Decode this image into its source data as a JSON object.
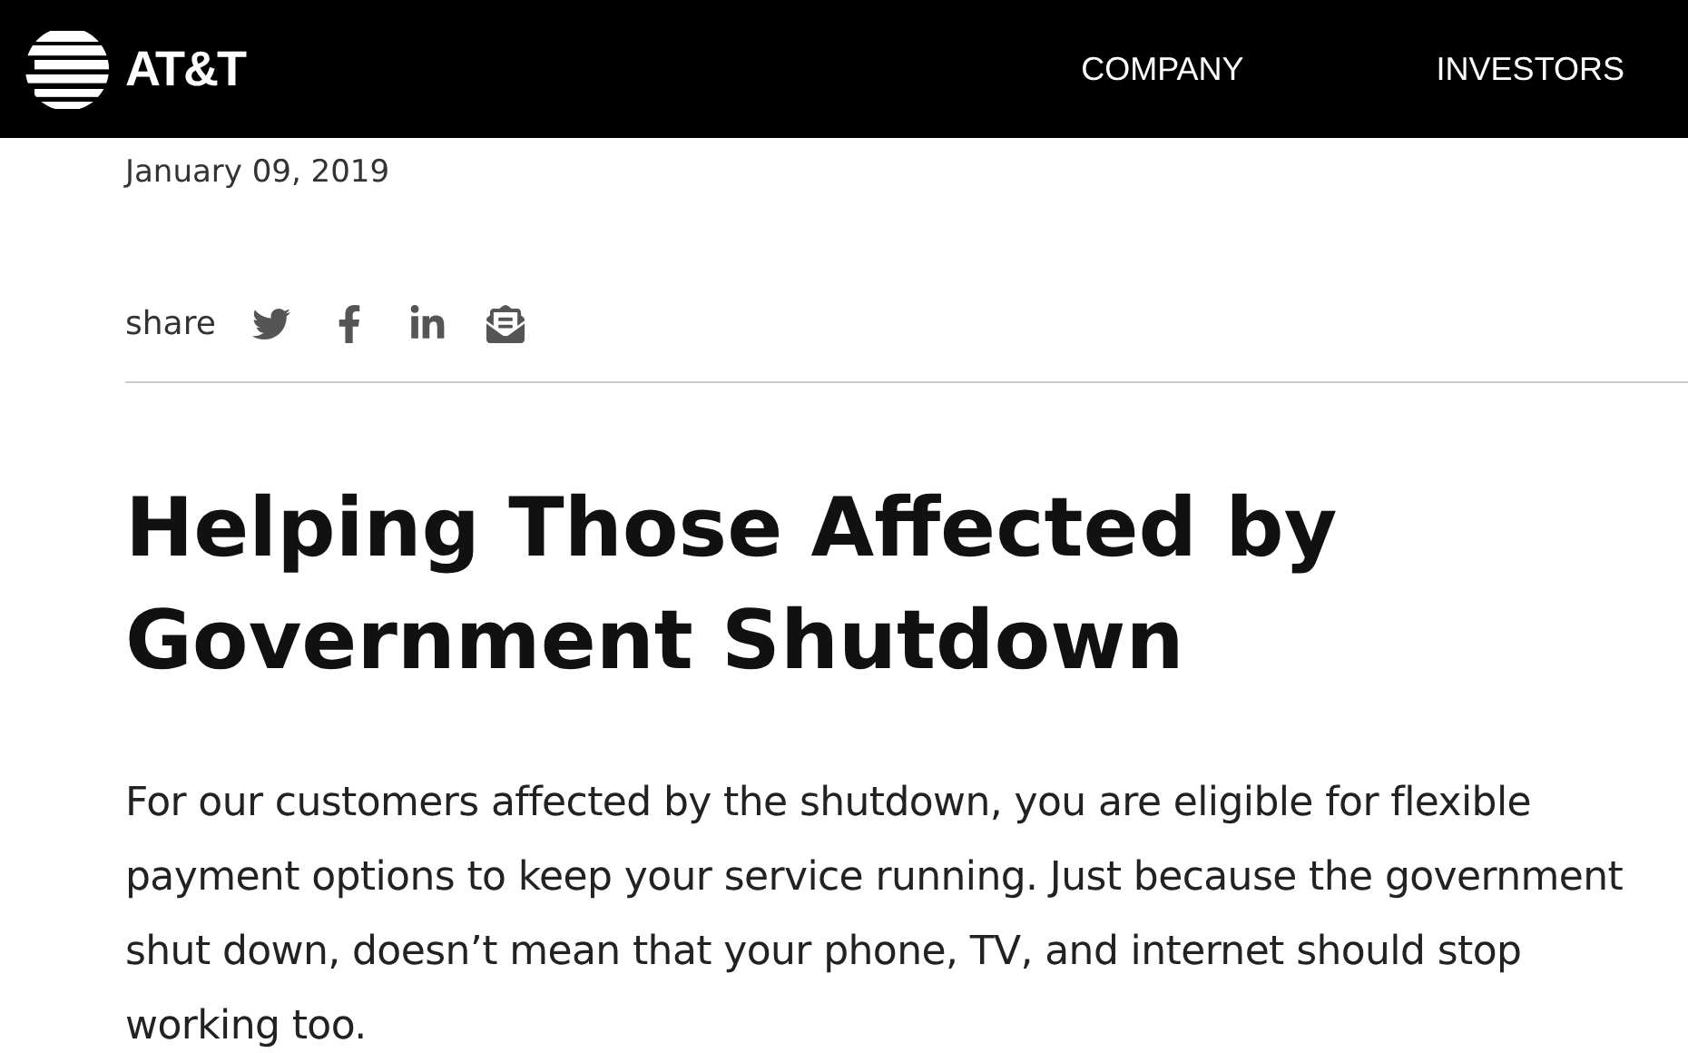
{
  "header": {
    "logo_text": "AT&T",
    "nav": [
      {
        "label": "COMPANY"
      },
      {
        "label": "INVESTORS"
      }
    ]
  },
  "article": {
    "date": "January 09, 2019",
    "share_label": "share",
    "share_links": [
      {
        "kind": "twitter"
      },
      {
        "kind": "facebook"
      },
      {
        "kind": "linkedin"
      },
      {
        "kind": "email"
      }
    ],
    "title": "Helping Those Affected by Government Shutdown",
    "body": "For our customers affected by the shutdown, you are eligible for flexible payment options to keep your service running. Just because the government shut down, doesn’t mean that your phone, TV, and internet should stop working too."
  }
}
